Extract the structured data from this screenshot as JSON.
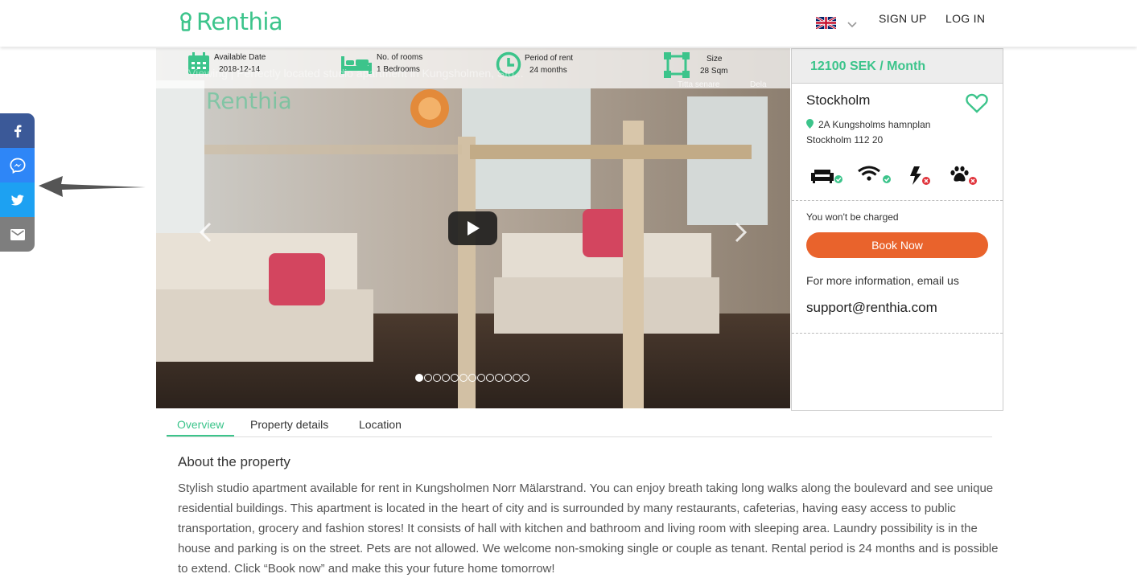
{
  "header": {
    "logo_text": "Renthia",
    "signup_label": "SIGN UP",
    "login_label": "LOG IN",
    "language_icon": "uk-flag-icon"
  },
  "share_bar": {
    "items": [
      "facebook-icon",
      "messenger-icon",
      "twitter-icon",
      "email-icon"
    ]
  },
  "info_bar": {
    "available": {
      "label": "Available Date",
      "value": "2018-12-14"
    },
    "rooms": {
      "label": "No. of rooms",
      "value": "1 Bedrooms"
    },
    "period": {
      "label": "Period of rent",
      "value": "24 months"
    },
    "size": {
      "label": "Size",
      "value": "28 Sqm"
    }
  },
  "video": {
    "title": "Viewing | Perfectly located studio apartment in Kungsholmen, Sto...",
    "watch_later": "Titta senare",
    "share": "Dela",
    "slide_count": 13,
    "active_slide": 0
  },
  "listing": {
    "price": "12100 SEK / Month",
    "city": "Stockholm",
    "address_line1": "2A Kungsholms hamnplan",
    "address_line2": "Stockholm 112 20",
    "amenities": [
      {
        "icon": "sofa-icon",
        "available": true
      },
      {
        "icon": "wifi-icon",
        "available": true
      },
      {
        "icon": "electricity-icon",
        "available": false
      },
      {
        "icon": "pets-icon",
        "available": false
      }
    ],
    "charged_note": "You won't be charged",
    "book_label": "Book Now",
    "more_info": "For more information, email us",
    "email": "support@renthia.com"
  },
  "tabs": [
    "Overview",
    "Property details",
    "Location"
  ],
  "about": {
    "title": "About the property",
    "text": "Stylish studio apartment available for rent in Kungsholmen Norr Mälarstrand. You can enjoy breath taking long walks along the boulevard and see unique residential buildings. This apartment is located in the heart of city and is surrounded by many restaurants, cafeterias, having easy access to public transportation, grocery and fashion stores! It consists of hall with kitchen and bathroom and living room with sleeping area. Laundry possibility is in the house and parking is on the street. Pets are not allowed. We welcome non-smoking single or couple as tenant. Rental period is 24 months and is possible to extend. Click “Book now” and make this your future home tomorrow!"
  },
  "colors": {
    "brand": "#3cc48b",
    "book": "#e9632c"
  }
}
